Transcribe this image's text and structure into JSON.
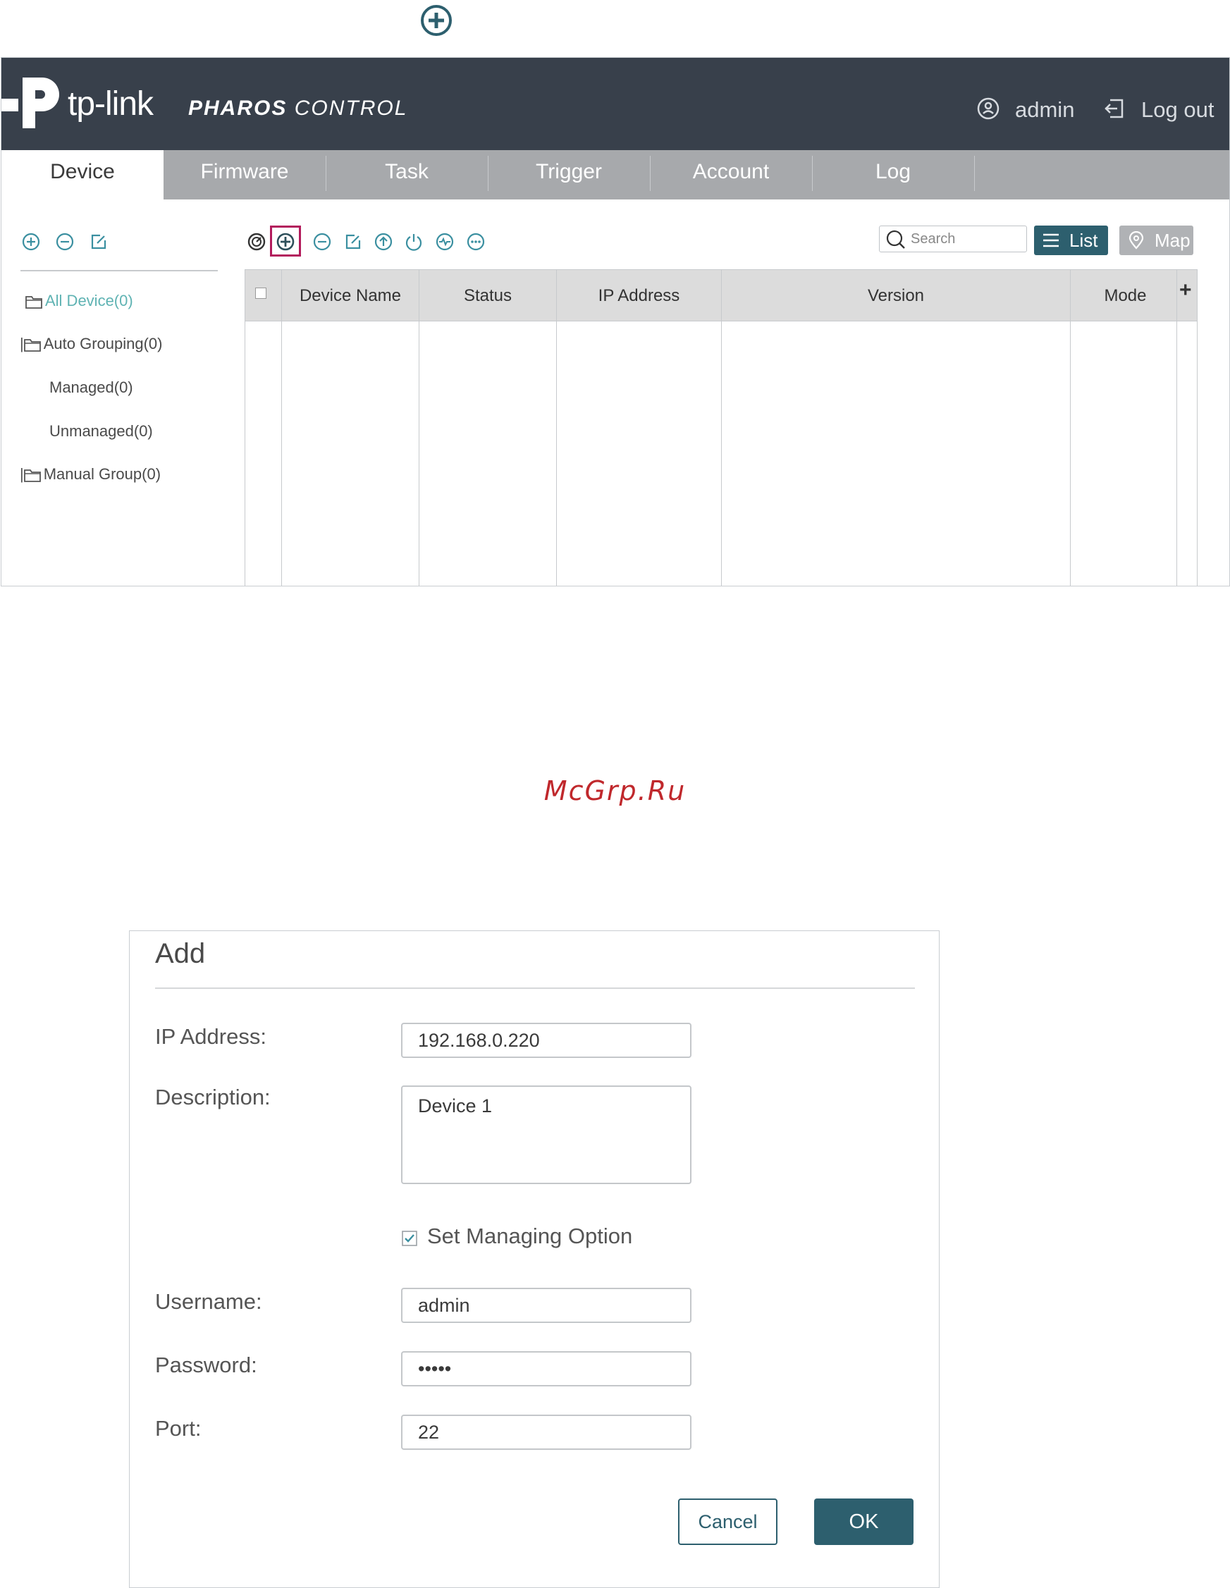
{
  "top_icon": "add-circle-icon",
  "app": {
    "brand": "tp-link",
    "product": {
      "bold": "PHAROS",
      "light": "CONTROL"
    },
    "user": {
      "name": "admin",
      "icon": "user-circle-icon"
    },
    "logout": {
      "label": "Log out",
      "icon": "logout-icon"
    },
    "tabs": [
      {
        "label": "Device",
        "active": true
      },
      {
        "label": "Firmware"
      },
      {
        "label": "Task"
      },
      {
        "label": "Trigger"
      },
      {
        "label": "Account"
      },
      {
        "label": "Log"
      }
    ],
    "sidebar": {
      "tools": [
        "add-icon",
        "remove-icon",
        "edit-icon"
      ],
      "tree": [
        {
          "label": "All Device(0)",
          "selected": true
        },
        {
          "label": "Auto Grouping(0)"
        },
        {
          "label": "Managed(0)"
        },
        {
          "label": "Unmanaged(0)"
        },
        {
          "label": "Manual Group(0)"
        }
      ]
    },
    "toolbar": {
      "tools": [
        "discover-icon",
        "add-icon",
        "remove-icon",
        "edit-icon",
        "upgrade-icon",
        "power-icon",
        "monitor-icon",
        "more-icon"
      ],
      "search_placeholder": "Search",
      "view_list": "List",
      "view_map": "Map"
    },
    "table": {
      "columns": [
        "Device Name",
        "Status",
        "IP Address",
        "Version",
        "Mode"
      ],
      "add_column": "+",
      "rows": []
    },
    "colors": {
      "header": "#38404b",
      "tabbar": "#a7a9ac",
      "accent": "#2d5f6e",
      "selected": "#5fb3b3",
      "highlight": "#b31b5c"
    }
  },
  "watermark": "McGrp.Ru",
  "dialog": {
    "title": "Add",
    "ip_label": "IP Address:",
    "ip_value": "192.168.0.220",
    "desc_label": "Description:",
    "desc_value": "Device 1",
    "managing_label": "Set Managing Option",
    "managing_checked": true,
    "username_label": "Username:",
    "username_value": "admin",
    "password_label": "Password:",
    "password_value": "•••••",
    "port_label": "Port:",
    "port_value": "22",
    "cancel": "Cancel",
    "ok": "OK"
  }
}
